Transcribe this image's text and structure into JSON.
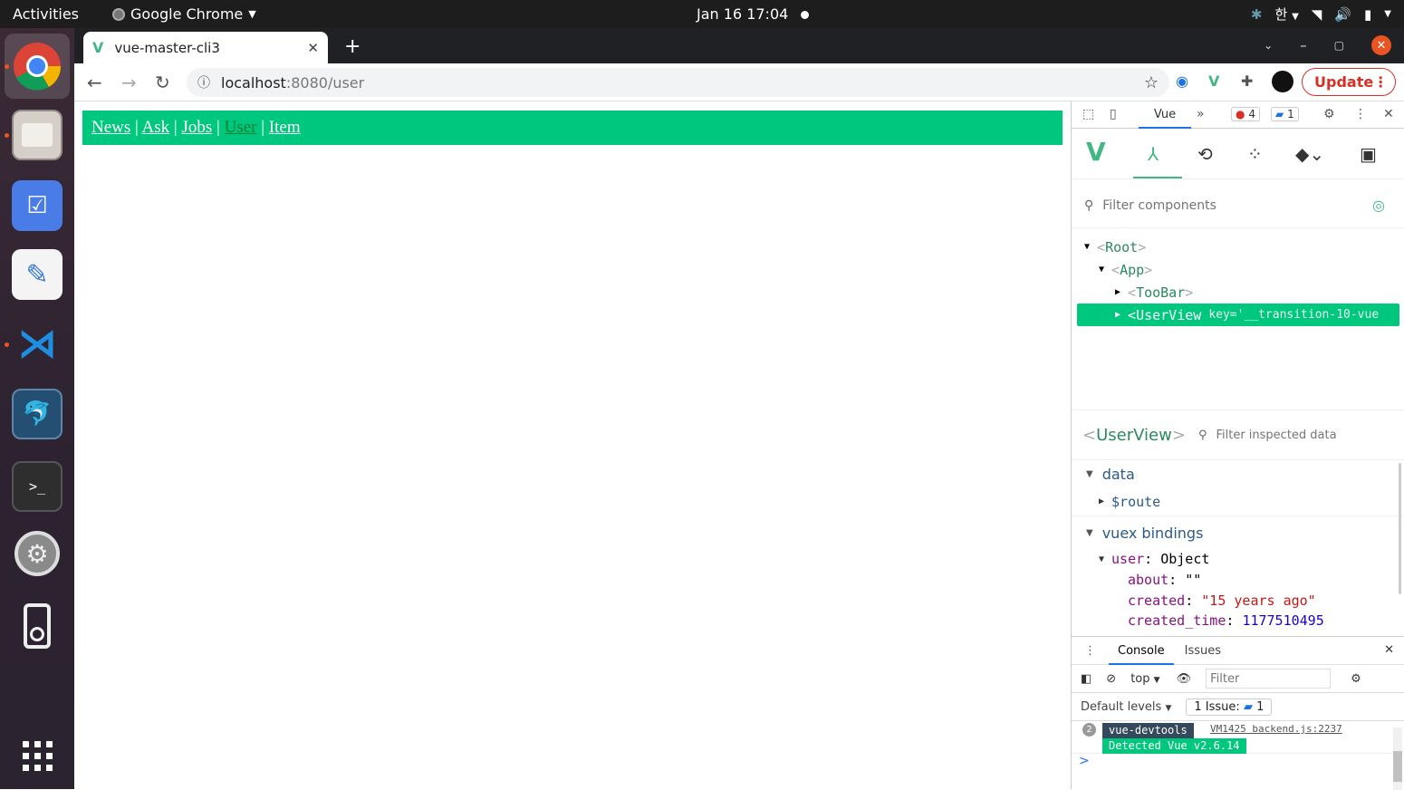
{
  "os": {
    "activities": "Activities",
    "app_menu": "Google Chrome",
    "clock": "Jan 16  17:04",
    "ime": "한"
  },
  "browser": {
    "tab_title": "vue-master-cli3",
    "url_host": "localhost",
    "url_path": ":8080/user",
    "update_label": "Update"
  },
  "page": {
    "nav": [
      "News",
      "Ask",
      "Jobs",
      "User",
      "Item"
    ],
    "separator": "|",
    "active": "User",
    "accent": "#00c77e",
    "active_color": "#067f2f"
  },
  "devtools": {
    "panel_tab": "Vue",
    "error_count": "4",
    "message_count": "1",
    "filter_components_placeholder": "Filter components",
    "tree": {
      "root": "Root",
      "app": "App",
      "toolbar": "TooBar",
      "userview": "UserView",
      "userview_key": "key='__transition-10-vue"
    },
    "inspector": {
      "component": "UserView",
      "filter_placeholder": "Filter inspected data",
      "data_section": "data",
      "route": "$route",
      "vuex_section": "vuex bindings",
      "user_key": "user",
      "user_type": "Object",
      "about_key": "about",
      "about_val": "\"\"",
      "created_key": "created",
      "created_val": "\"15 years ago\"",
      "created_time_key": "created_time",
      "created_time_val": "1177510495"
    },
    "console": {
      "tab_console": "Console",
      "tab_issues": "Issues",
      "context": "top",
      "filter_placeholder": "Filter",
      "levels": "Default levels",
      "issues_label": "1 Issue:",
      "issues_count": "1",
      "msg_count": "2",
      "msg_badge": "vue-devtools",
      "msg_source": "VM1425 backend.js:2237",
      "msg_detected": "Detected Vue v2.6.14",
      "prompt": ">"
    }
  }
}
